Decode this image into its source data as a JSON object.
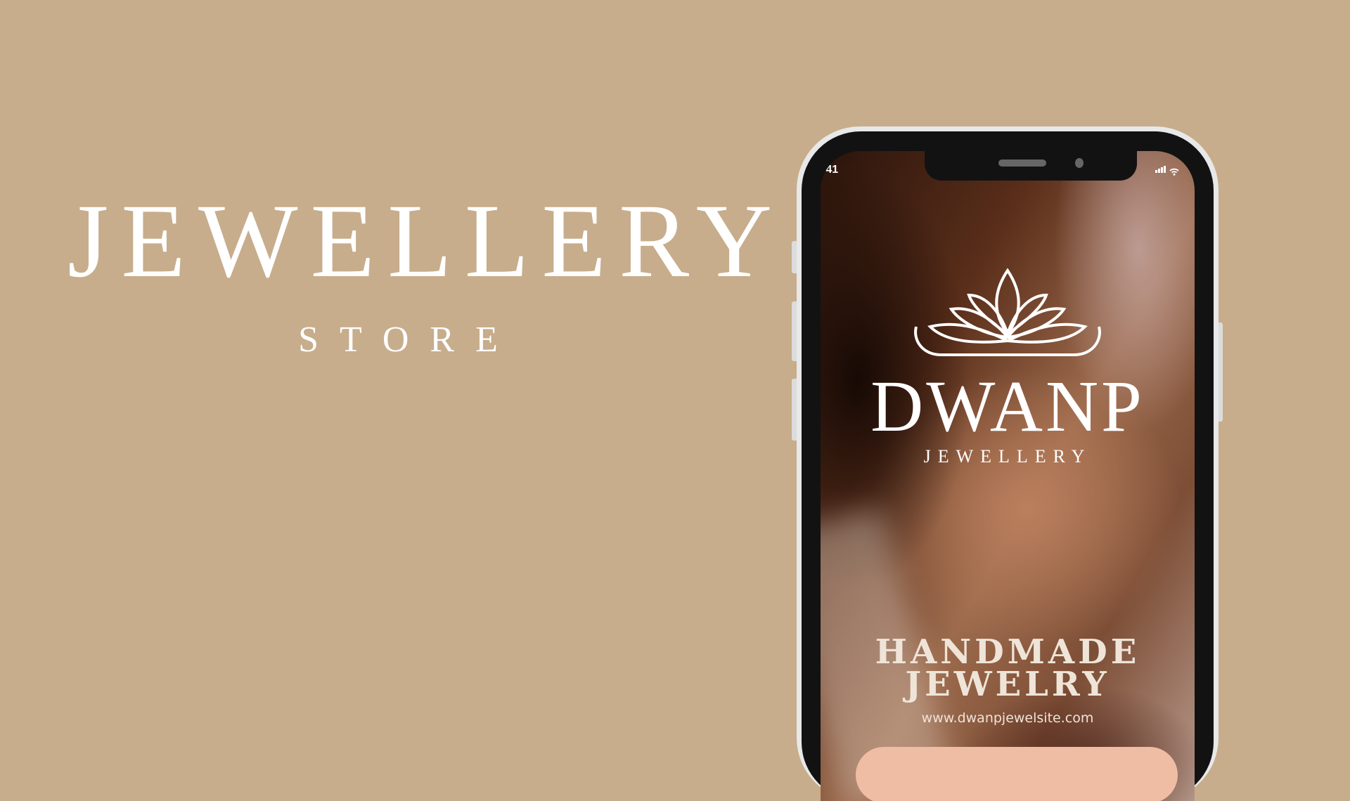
{
  "hero": {
    "title": "JEWELLERY",
    "subtitle": "STORE"
  },
  "phone": {
    "status_bar": {
      "time": ":41",
      "icons": [
        "signal-icon",
        "wifi-icon"
      ]
    },
    "logo": {
      "brand": "DWANP",
      "tagline": "JEWELLERY",
      "icon": "crown-lotus-icon"
    },
    "headline_line1": "HANDMADE",
    "headline_line2": "JEWELRY",
    "url": "www.dwanpjewelsite.com"
  },
  "colors": {
    "background": "#c7ad8c",
    "accent": "#efbda4",
    "text": "#ffffff"
  }
}
